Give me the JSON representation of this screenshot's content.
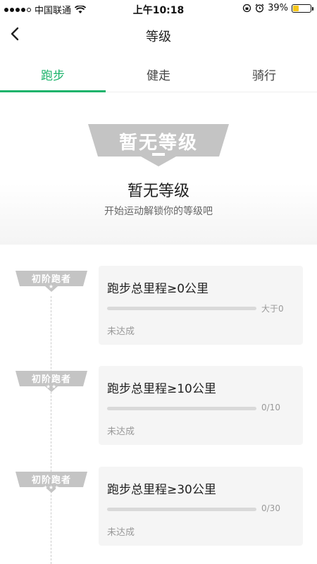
{
  "status_bar": {
    "carrier": "中国联通",
    "time": "上午10:18",
    "battery_percent": "39%",
    "battery_level": 0.39,
    "battery_color": "#f5c518"
  },
  "nav": {
    "back_icon": "chevron-left-icon",
    "title": "等级"
  },
  "tabs": [
    {
      "label": "跑步",
      "active": true
    },
    {
      "label": "健走",
      "active": false
    },
    {
      "label": "骑行",
      "active": false
    }
  ],
  "hero": {
    "badge_text": "暂无等级",
    "title": "暂无等级",
    "subtitle": "开始运动解锁你的等级吧"
  },
  "levels": [
    {
      "badge": "初阶跑者",
      "stars": "★",
      "title": "跑步总里程≥0公里",
      "progress_text": "大于0",
      "progress": 0,
      "status": "未达成"
    },
    {
      "badge": "初阶跑者",
      "stars": "★★",
      "title": "跑步总里程≥10公里",
      "progress_text": "0/10",
      "progress": 0,
      "status": "未达成"
    },
    {
      "badge": "初阶跑者",
      "stars": "★★★",
      "title": "跑步总里程≥30公里",
      "progress_text": "0/30",
      "progress": 0,
      "status": "未达成"
    }
  ],
  "colors": {
    "accent": "#1bb36b",
    "badge_gray": "#c4c4c4"
  }
}
